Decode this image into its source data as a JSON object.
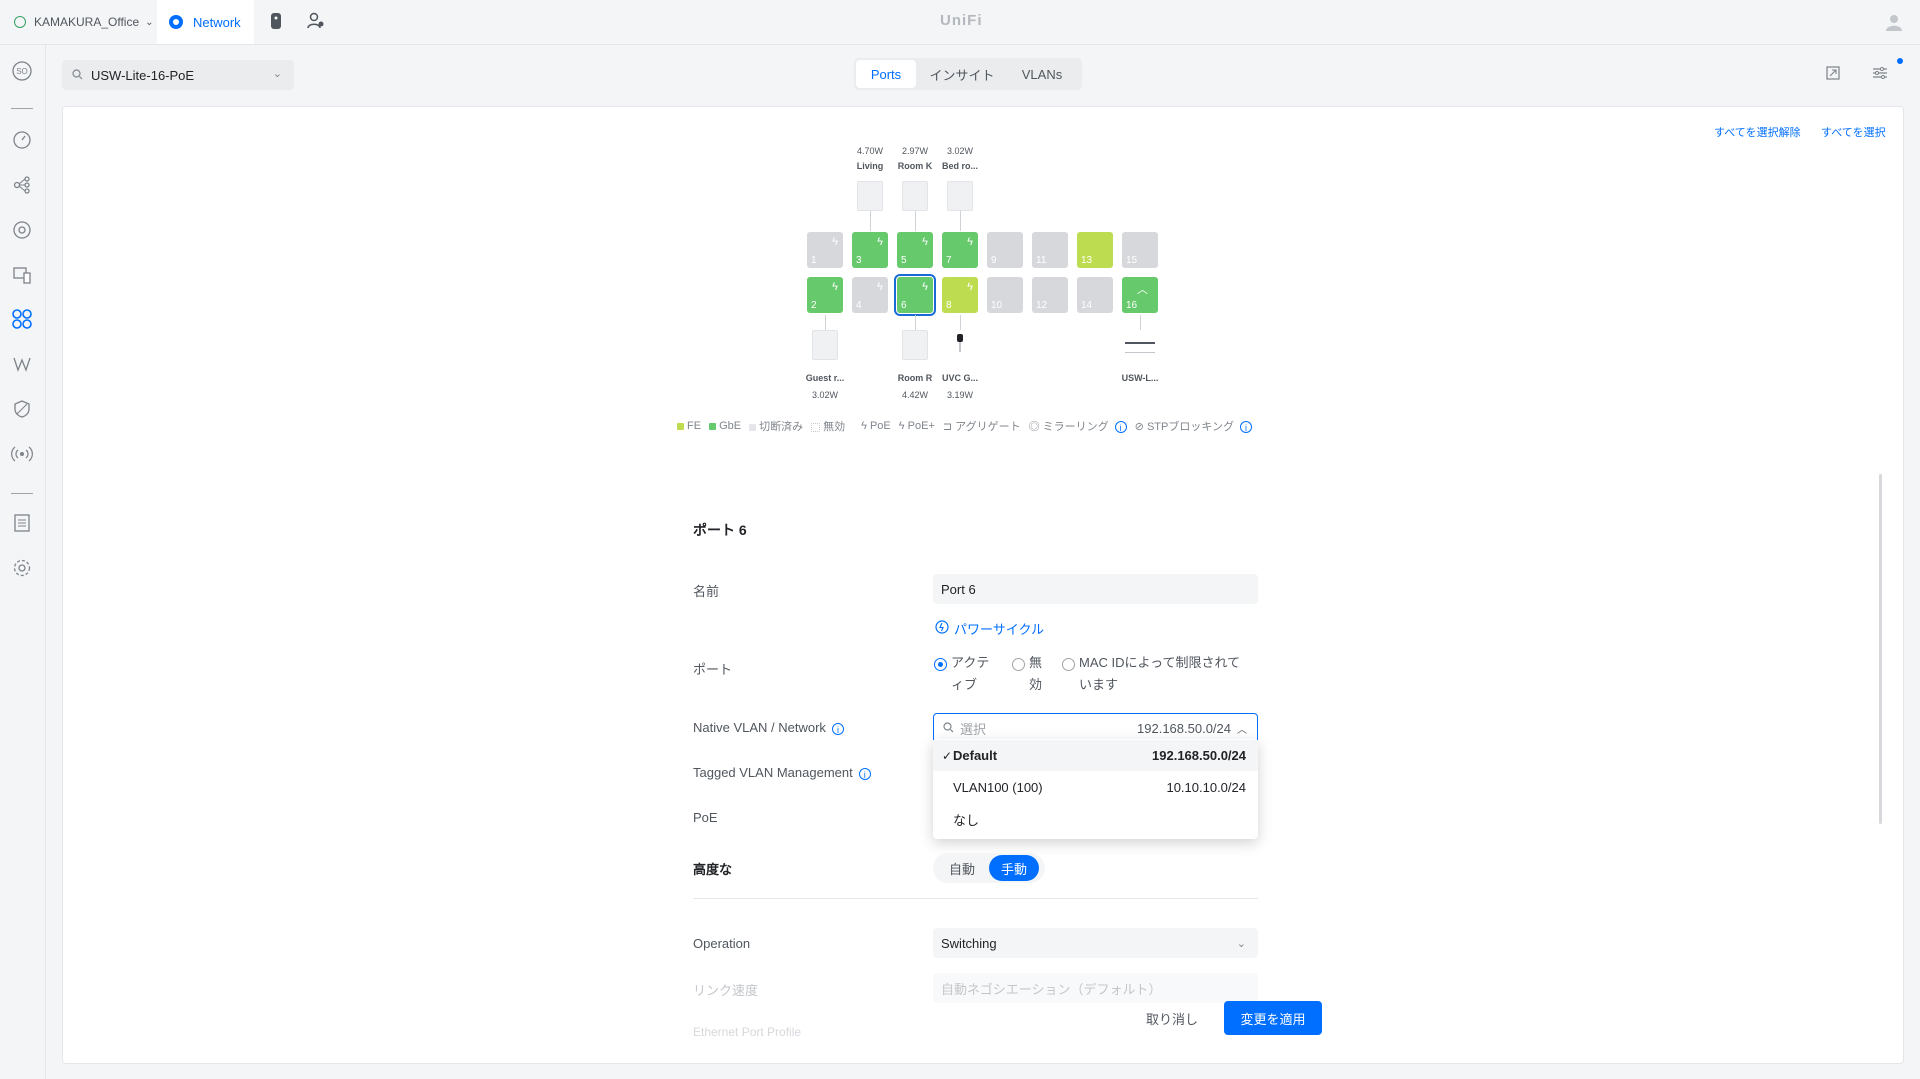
{
  "topbar": {
    "site_name": "KAMAKURA_Office",
    "network_tab": "Network",
    "brand": "UniFi"
  },
  "device_selector": {
    "value": "USW-Lite-16-PoE"
  },
  "tabs": [
    {
      "label": "Ports",
      "active": true
    },
    {
      "label": "インサイト",
      "active": false
    },
    {
      "label": "VLANs",
      "active": false
    }
  ],
  "panel_links": {
    "deselect_all": "すべてを選択解除",
    "select_all": "すべてを選択"
  },
  "ports": [
    {
      "num": "1",
      "color": "#d6d8dc",
      "poe": true
    },
    {
      "num": "3",
      "color": "#66c96b",
      "poe": true
    },
    {
      "num": "5",
      "color": "#66c96b",
      "poe": true
    },
    {
      "num": "7",
      "color": "#66c96b",
      "poe": true
    },
    {
      "num": "9",
      "color": "#d6d8dc",
      "poe": false
    },
    {
      "num": "11",
      "color": "#d6d8dc",
      "poe": false
    },
    {
      "num": "13",
      "color": "#bedc4f",
      "poe": false
    },
    {
      "num": "15",
      "color": "#d6d8dc",
      "poe": false
    },
    {
      "num": "2",
      "color": "#66c96b",
      "poe": true
    },
    {
      "num": "4",
      "color": "#d6d8dc",
      "poe": true
    },
    {
      "num": "6",
      "color": "#66c96b",
      "poe": true,
      "selected": true
    },
    {
      "num": "8",
      "color": "#bedc4f",
      "poe": true
    },
    {
      "num": "10",
      "color": "#d6d8dc",
      "poe": false
    },
    {
      "num": "12",
      "color": "#d6d8dc",
      "poe": false
    },
    {
      "num": "14",
      "color": "#d6d8dc",
      "poe": false
    },
    {
      "num": "16",
      "color": "#66c96b",
      "poe": false,
      "uplink": true
    }
  ],
  "top_devices": [
    {
      "watt": "4.70W",
      "name": "Living"
    },
    {
      "watt": "2.97W",
      "name": "Room K"
    },
    {
      "watt": "3.02W",
      "name": "Bed ro..."
    }
  ],
  "bottom_devices": [
    {
      "name": "Guest r...",
      "watt": "3.02W"
    },
    {
      "name": "Room R",
      "watt": "4.42W"
    },
    {
      "name": "UVC G...",
      "watt": "3.19W"
    },
    {
      "name": "USW-L..."
    }
  ],
  "legend": {
    "fe": "FE",
    "gbe": "GbE",
    "disconnected": "切断済み",
    "disabled": "無効",
    "poe": "PoE",
    "poe_plus": "PoE+",
    "aggregate": "アグリゲート",
    "mirroring": "ミラーリング",
    "stp": "STPブロッキング",
    "colors": {
      "fe": "#bedc4f",
      "gbe": "#66c96b",
      "disconnected": "#e4e6e9"
    }
  },
  "form": {
    "title": "ポート 6",
    "name_label": "名前",
    "name_value": "Port 6",
    "power_cycle": "パワーサイクル",
    "port_label": "ポート",
    "port_options": [
      {
        "label": "アクティブ",
        "checked": true
      },
      {
        "label": "無効",
        "checked": false
      },
      {
        "label": "MAC IDによって制限されています",
        "checked": false
      }
    ],
    "native_vlan_label": "Native VLAN / Network",
    "search_placeholder": "選択",
    "selected_subnet": "192.168.50.0/24",
    "tagged_label": "Tagged VLAN Management",
    "poe_label": "PoE",
    "advanced_label": "高度な",
    "advanced_auto": "自動",
    "advanced_manual": "手動",
    "operation_label": "Operation",
    "operation_value": "Switching",
    "link_speed_label": "リンク速度",
    "link_speed_value": "自動ネゴシエーション（デフォルト）",
    "profile_label": "Ethernet Port Profile"
  },
  "dropdown": [
    {
      "name": "Default",
      "subnet": "192.168.50.0/24",
      "checked": true
    },
    {
      "name": "VLAN100 (100)",
      "subnet": "10.10.10.0/24",
      "checked": false
    },
    {
      "name": "なし",
      "subnet": "",
      "checked": false
    }
  ],
  "actions": {
    "cancel": "取り消し",
    "apply": "変更を適用"
  }
}
